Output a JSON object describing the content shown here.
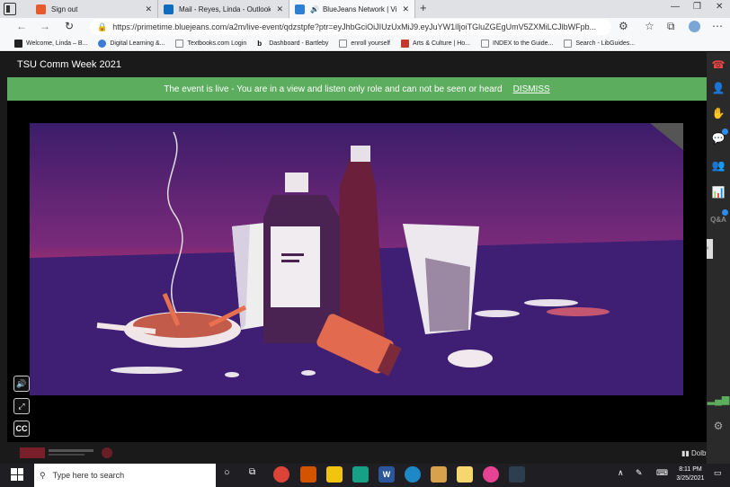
{
  "browser": {
    "tabs": [
      {
        "title": "Sign out",
        "favicon_color": "#e85a2c"
      },
      {
        "title": "Mail - Reyes, Linda - Outlook",
        "favicon_color": "#0f6cbd"
      },
      {
        "title": "BlueJeans Network | Video",
        "favicon_color": "#2d7fd3",
        "active": true
      }
    ],
    "new_tab_label": "+",
    "window_controls": [
      "—",
      "❐",
      "✕"
    ],
    "url": "https://primetime.bluejeans.com/a2m/live-event/qdzstpfe?ptr=eyJhbGciOiJIUzUxMiJ9.eyJuYW1lIjoiTGluZGEgUmV5ZXMiLCJlbWFpb...",
    "bookmarks": [
      {
        "label": "Welcome, Linda – B...",
        "color": "#222"
      },
      {
        "label": "Digital Learning &...",
        "color": "#3a7bd5"
      },
      {
        "label": "Textbooks.com Login",
        "color": "#888"
      },
      {
        "label": "Dashboard - Bartleby",
        "color": "#222"
      },
      {
        "label": "enroll yourself",
        "color": "#888"
      },
      {
        "label": "Arts & Culture | Ho...",
        "color": "#c0392b"
      },
      {
        "label": "INDEX to the Guide...",
        "color": "#888"
      },
      {
        "label": "Search - LibGuides...",
        "color": "#888"
      }
    ]
  },
  "event": {
    "title": "TSU Comm Week 2021",
    "banner_text": "The event is live - You are in a view and listen only role and can not be seen or heard",
    "dismiss_label": "DISMISS",
    "cc_label": "CC",
    "dolby_label": "Dolby Voice",
    "accent_green": "#5cad5e"
  },
  "taskbar": {
    "search_placeholder": "Type here to search",
    "time": "8:11 PM",
    "date": "3/25/2021"
  }
}
